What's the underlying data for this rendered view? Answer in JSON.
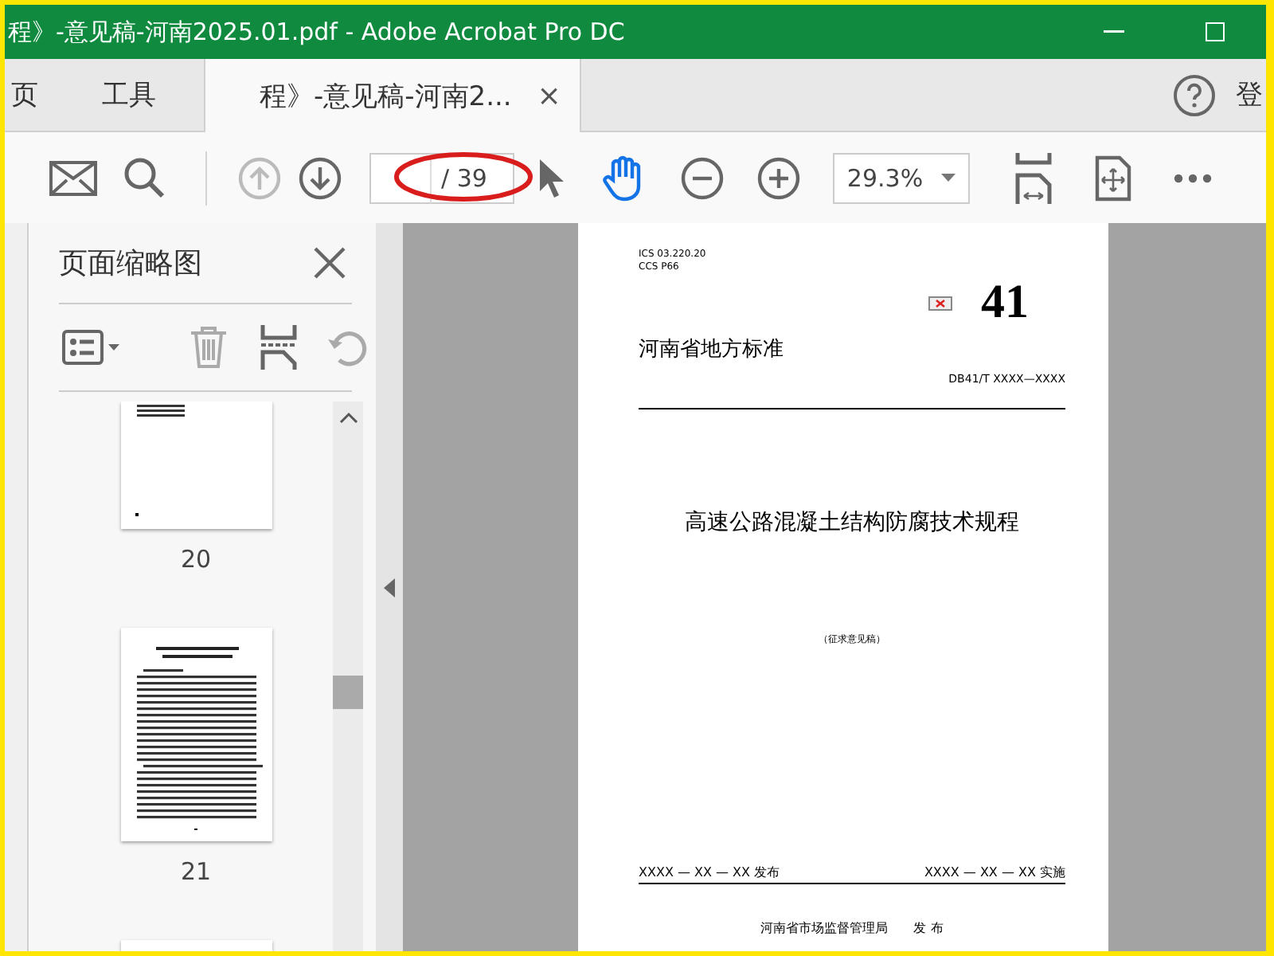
{
  "window": {
    "title": "程》-意见稿-河南2025.01.pdf - Adobe Acrobat Pro DC"
  },
  "nav_tabs": [
    {
      "label": "页",
      "selected": false
    },
    {
      "label": "工具",
      "selected": false
    },
    {
      "label": "程》-意见稿-河南2...",
      "selected": true
    }
  ],
  "tab_close": "×",
  "account_label": "登",
  "toolbar": {
    "page_total": "/ 39",
    "zoom": "29.3%",
    "page_input_highlighted": true,
    "previous_page_disabled": true,
    "hand_tool_selected": true
  },
  "thumbnail_panel": {
    "title": "页面缩略图",
    "undo_disabled": true,
    "thumbnails": [
      {
        "label": "20",
        "kind": "sparse"
      },
      {
        "label": "21",
        "kind": "dense"
      },
      {
        "kind": "cut"
      }
    ]
  },
  "document": {
    "ics": "ICS  03.220.20",
    "ccs": "CCS  P66",
    "number": "41",
    "standard_type": "河南省地方标准",
    "code": "DB41/T XXXX—XXXX",
    "title": "高速公路混凝土结构防腐技术规程",
    "subtitle": "（征求意见稿）",
    "issue_date": "XXXX — XX — XX 发布",
    "effective_date": "XXXX — XX — XX 实施",
    "issuer": "河南省市场监督管理局　　发 布"
  }
}
